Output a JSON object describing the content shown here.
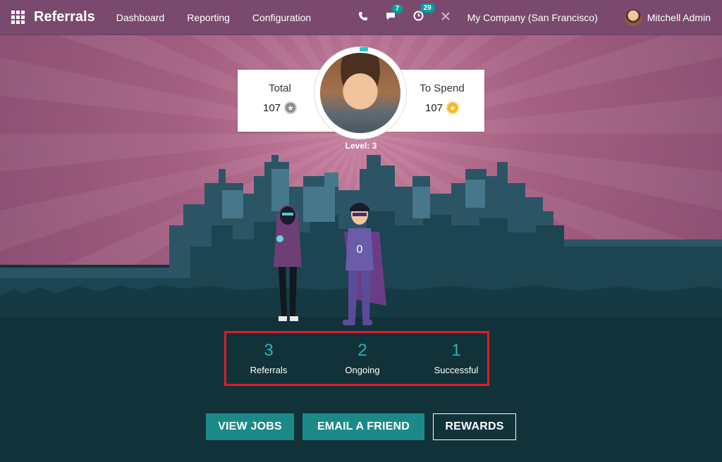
{
  "navbar": {
    "app_title": "Referrals",
    "menu": [
      "Dashboard",
      "Reporting",
      "Configuration"
    ],
    "messages_badge": "7",
    "activities_badge": "29",
    "company": "My Company (San Francisco)",
    "user": "Mitchell Admin"
  },
  "stats": {
    "total_label": "Total",
    "total_value": "107",
    "spend_label": "To Spend",
    "spend_value": "107",
    "level": "Level: 3"
  },
  "counts": {
    "referrals_value": "3",
    "referrals_label": "Referrals",
    "ongoing_value": "2",
    "ongoing_label": "Ongoing",
    "successful_value": "1",
    "successful_label": "Successful"
  },
  "actions": {
    "view_jobs": "VIEW JOBS",
    "email_friend": "EMAIL A FRIEND",
    "rewards": "REWARDS"
  },
  "colors": {
    "navbar": "#7a4a6e",
    "accent": "#1b8a87",
    "ground": "#12323a",
    "highlight_border": "#e01b24"
  }
}
